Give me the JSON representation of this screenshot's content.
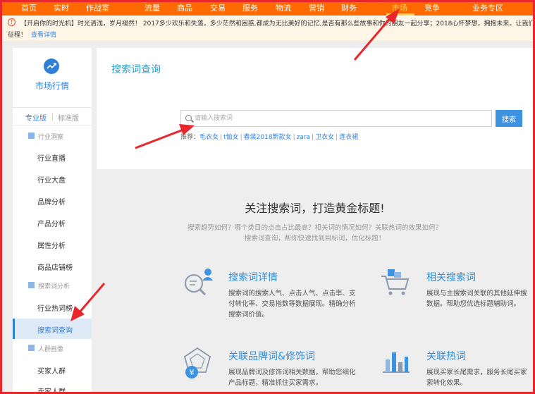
{
  "topnav": {
    "items": [
      {
        "label": "首页"
      },
      {
        "label": "实时"
      },
      {
        "label": "作战室"
      },
      {
        "label": "流量"
      },
      {
        "label": "商品"
      },
      {
        "label": "交易"
      },
      {
        "label": "服务"
      },
      {
        "label": "物流"
      },
      {
        "label": "营销"
      },
      {
        "label": "财务"
      },
      {
        "label": "市场"
      },
      {
        "label": "竞争"
      },
      {
        "label": "业务专区"
      }
    ],
    "active": "市场",
    "active_color": "#ffd35a",
    "bar_color": "#ff6a00"
  },
  "notice": {
    "line1": "【开启你的时光机】时光清浅，岁月褪然！ 2017多少欢乐和失落，多少茫然和困惑,都成为无比美好的记忆,是否有那么些故事和你的朋友一起分享；2018心怀梦想，拥抱未来。让我们憧憬更美",
    "line2": "征程！",
    "link": "查看详情"
  },
  "sidebar": {
    "title": "市场行情",
    "versions": [
      "专业版",
      "标准版"
    ],
    "groups": {
      "industry": "行业洞察",
      "search": "搜索词分析",
      "crowd": "人群画像"
    },
    "items": {
      "industry_live": "行业直播",
      "industry_board": "行业大盘",
      "brand": "品牌分析",
      "product": "产品分析",
      "attribute": "属性分析",
      "shop_rank": "商品店铺榜",
      "hot_words": "行业热词榜",
      "search_query": "搜索词查询",
      "buyer_crowd": "买家人群",
      "seller_crowd": "卖家人群"
    }
  },
  "main": {
    "title": "搜索词查询",
    "search_placeholder": "请输入搜索词",
    "search_button": "搜索",
    "reco_label": "推荐：",
    "reco_items": [
      "毛衣女",
      "t恤女",
      "春装2018新款女",
      "zara",
      "卫衣女",
      "连衣裙"
    ],
    "headline": "关注搜索词，打造黄金标题!",
    "subline1": "搜索趋势如何？哪个类目的点击占比最高？相关词的情况如何？关联热词的效果如何？",
    "subline2": "搜索词查询，帮你快速找到目标词，优化标题！"
  },
  "features": [
    {
      "title": "搜索词详情",
      "icon": "search-person-icon",
      "desc": [
        "搜索词的搜索人气、点击人气、点击率、支",
        "付转化率、交易指数等数据展现。精确分析",
        "搜索词价值。"
      ]
    },
    {
      "title": "相关搜索词",
      "icon": "cart-icon",
      "desc": [
        "展现与主搜索词关联的其他延伸搜",
        "数据。帮助您优选标题辅助词。"
      ]
    },
    {
      "title": "关联品牌词&修饰词",
      "icon": "radar-yen-icon",
      "desc": [
        "展现品牌词及修饰词相关数据，帮助您细化",
        "产品标题，精准抓住买家需求。"
      ]
    },
    {
      "title": "关联热词",
      "icon": "bar-chart-icon",
      "desc": [
        "展现买家长尾需求，服务长尾买家",
        "索转化效果。"
      ]
    }
  ],
  "colors": {
    "frame": "#e8262b",
    "accent": "#2f7fd8",
    "title_teal": "#28a1c8",
    "arrow": "#e8262b"
  }
}
